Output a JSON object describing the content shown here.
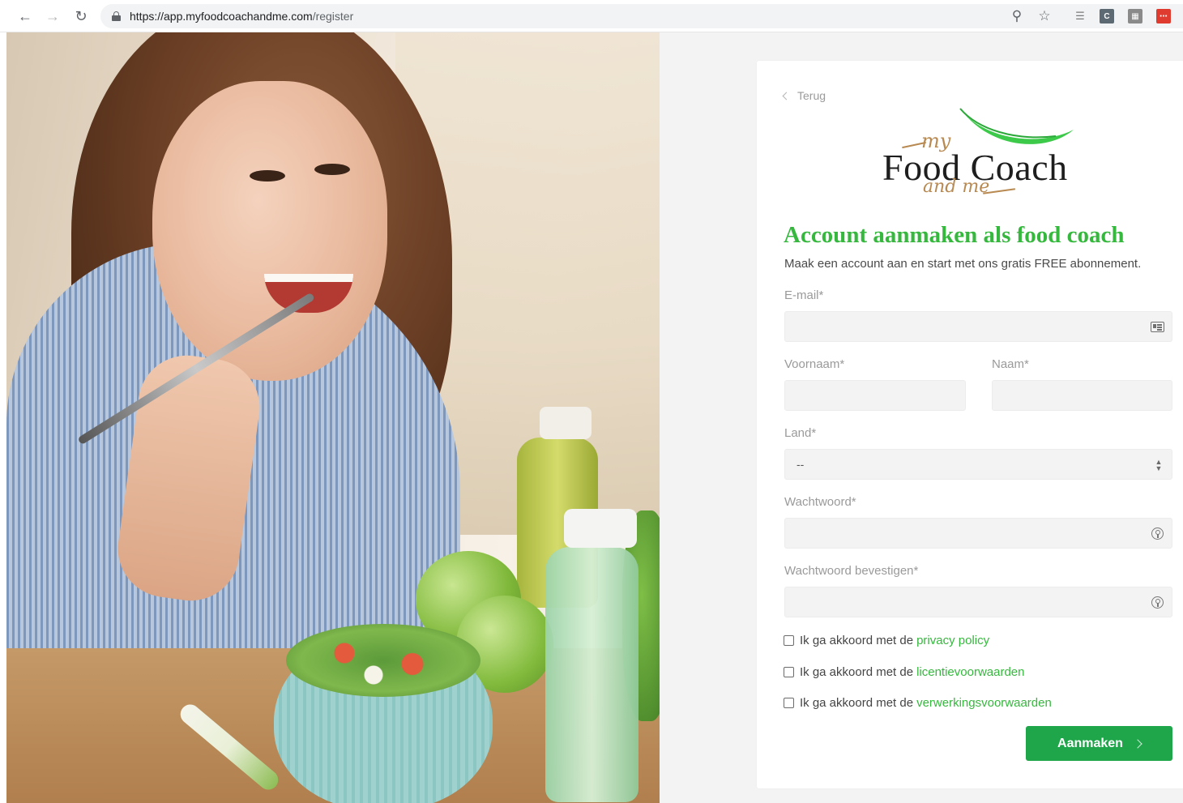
{
  "browser": {
    "url_domain": "https://app.myfoodcoachandme.com",
    "url_path": "/register"
  },
  "page": {
    "back_label": "Terug",
    "logo": {
      "my": "my",
      "food": "Food",
      "coach": "Coach",
      "and_me": "and me"
    },
    "title": "Account aanmaken als food coach",
    "subtitle": "Maak een account aan en start met ons gratis FREE abonnement.",
    "form": {
      "email_label": "E-mail*",
      "email_value": "",
      "firstname_label": "Voornaam*",
      "firstname_value": "",
      "lastname_label": "Naam*",
      "lastname_value": "",
      "country_label": "Land*",
      "country_selected": "--",
      "password_label": "Wachtwoord*",
      "password_value": "",
      "password_confirm_label": "Wachtwoord bevestigen*",
      "password_confirm_value": ""
    },
    "agreements": [
      {
        "prefix": "Ik ga akkoord met de",
        "link": "privacy policy",
        "checked": false
      },
      {
        "prefix": "Ik ga akkoord met de",
        "link": "licentievoorwaarden",
        "checked": false
      },
      {
        "prefix": "Ik ga akkoord met de",
        "link": "verwerkingsvoorwaarden",
        "checked": false
      }
    ],
    "submit_label": "Aanmaken"
  },
  "colors": {
    "brand_green": "#36b83e",
    "button_green": "#1fa64a",
    "logo_gold": "#b88a52"
  },
  "icons": {
    "back": "chevron-left-icon",
    "email_field": "contact-card-icon",
    "password_field": "key-icon",
    "select": "sort-arrows-icon",
    "submit": "chevron-right-icon"
  }
}
